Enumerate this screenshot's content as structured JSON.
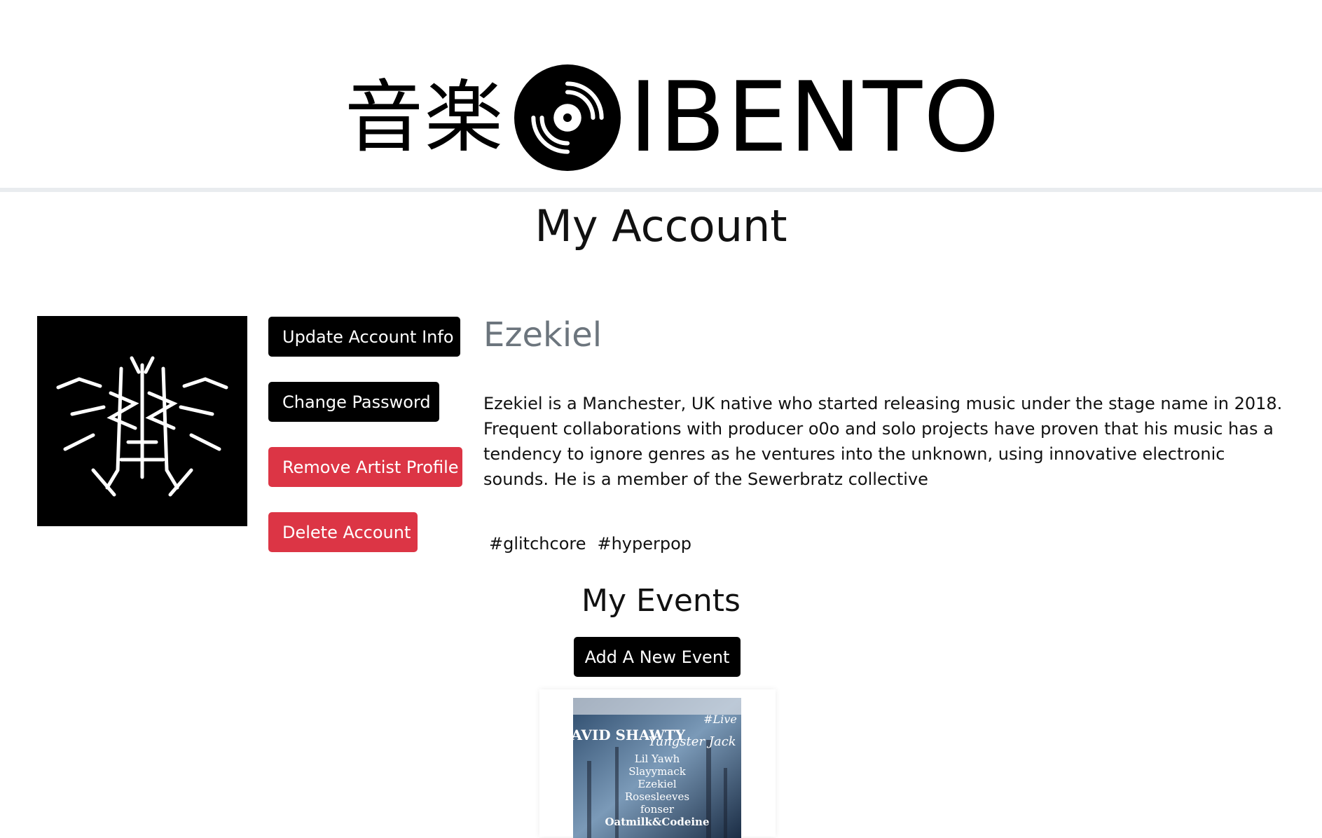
{
  "header": {
    "logo_kanji": "音楽",
    "logo_word": "IBENTO",
    "disc_icon": "vinyl-record-icon"
  },
  "page": {
    "title": "My Account"
  },
  "account": {
    "avatar_icon": "artist-logo-image",
    "buttons": {
      "update": "Update Account Info",
      "password": "Change Password",
      "remove_artist": "Remove Artist Profile",
      "delete": "Delete Account"
    },
    "name": "Ezekiel",
    "bio": "Ezekiel is a Manchester, UK native who started releasing music under the stage name in 2018. Frequent collaborations with producer o0o and solo projects have proven that his music has a tendency to ignore genres as he ventures into the unknown, using innovative electronic sounds. He is a member of the Sewerbratz collective",
    "tags": [
      "#glitchcore",
      "#hyperpop"
    ]
  },
  "events": {
    "title": "My Events",
    "add_button": "Add A New Event",
    "cards": [
      {
        "poster_icon": "event-poster-image",
        "poster_lines": [
          "DAVID SHAWTY",
          "Yungster Jack",
          "#Live",
          "Lil Yawh",
          "Slayymack",
          "Ezekiel",
          "Rosesleeves",
          "fonser",
          "Oatmilk&Codeine"
        ]
      }
    ]
  },
  "colors": {
    "danger": "#dc3545",
    "dark": "#000000",
    "muted": "#6c757d",
    "divider": "#e9ecef"
  }
}
